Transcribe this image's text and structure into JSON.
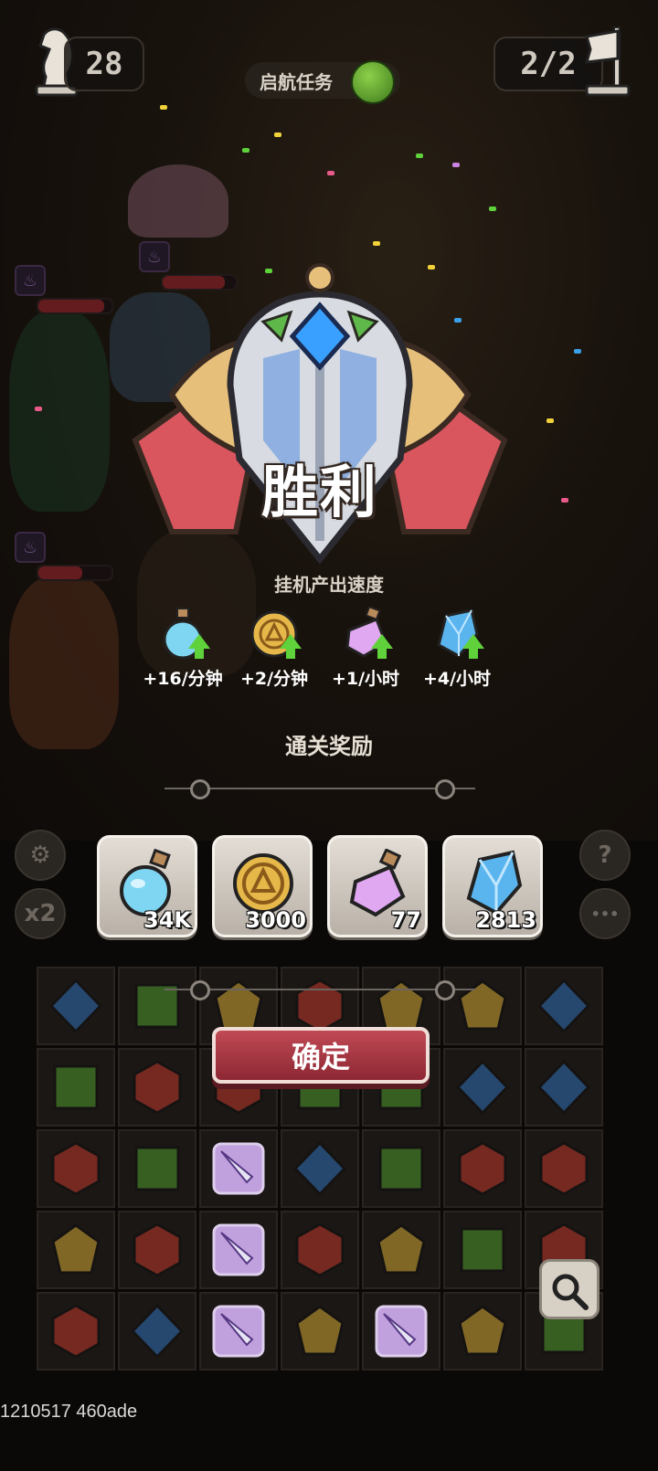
{
  "hud": {
    "level": "28",
    "waves": "2/2",
    "quest_label": "启航任务"
  },
  "victory": {
    "title": "胜利",
    "idle_rate_title": "挂机产出速度",
    "rates": [
      {
        "icon": "blue-potion-icon",
        "text": "+16/分钟"
      },
      {
        "icon": "gold-coin-icon",
        "text": "+2/分钟"
      },
      {
        "icon": "purple-potion-icon",
        "text": "+1/小时"
      },
      {
        "icon": "blue-crystal-icon",
        "text": "+4/小时"
      }
    ],
    "clear_reward_title": "通关奖励",
    "rewards": [
      {
        "icon": "blue-potion-icon",
        "count": "34K"
      },
      {
        "icon": "gold-coin-icon",
        "count": "3000"
      },
      {
        "icon": "purple-potion-icon",
        "count": "77"
      },
      {
        "icon": "blue-crystal-icon",
        "count": "2813"
      }
    ],
    "confirm_label": "确定"
  },
  "side_buttons": {
    "speed_label": "x2",
    "help_label": "?",
    "more_label": "•••"
  },
  "colors": {
    "accent_red": "#b03a46",
    "gem_red": "#c0392b",
    "gem_blue": "#2f6fb8",
    "gem_green": "#4e9a2c",
    "gem_gold": "#d4a936"
  },
  "board": {
    "rows": [
      [
        "blue",
        "green",
        "gold",
        "red",
        "gold",
        "gold",
        "blue"
      ],
      [
        "green",
        "red",
        "red",
        "green",
        "green",
        "blue",
        "blue"
      ],
      [
        "red",
        "green",
        "sword",
        "blue",
        "green",
        "red",
        "red"
      ],
      [
        "gold",
        "red",
        "sword",
        "red",
        "gold",
        "green",
        "red"
      ],
      [
        "red",
        "blue",
        "sword",
        "gold",
        "sword",
        "gold",
        "green"
      ]
    ]
  },
  "footer": {
    "version": "1210517 460ade"
  }
}
